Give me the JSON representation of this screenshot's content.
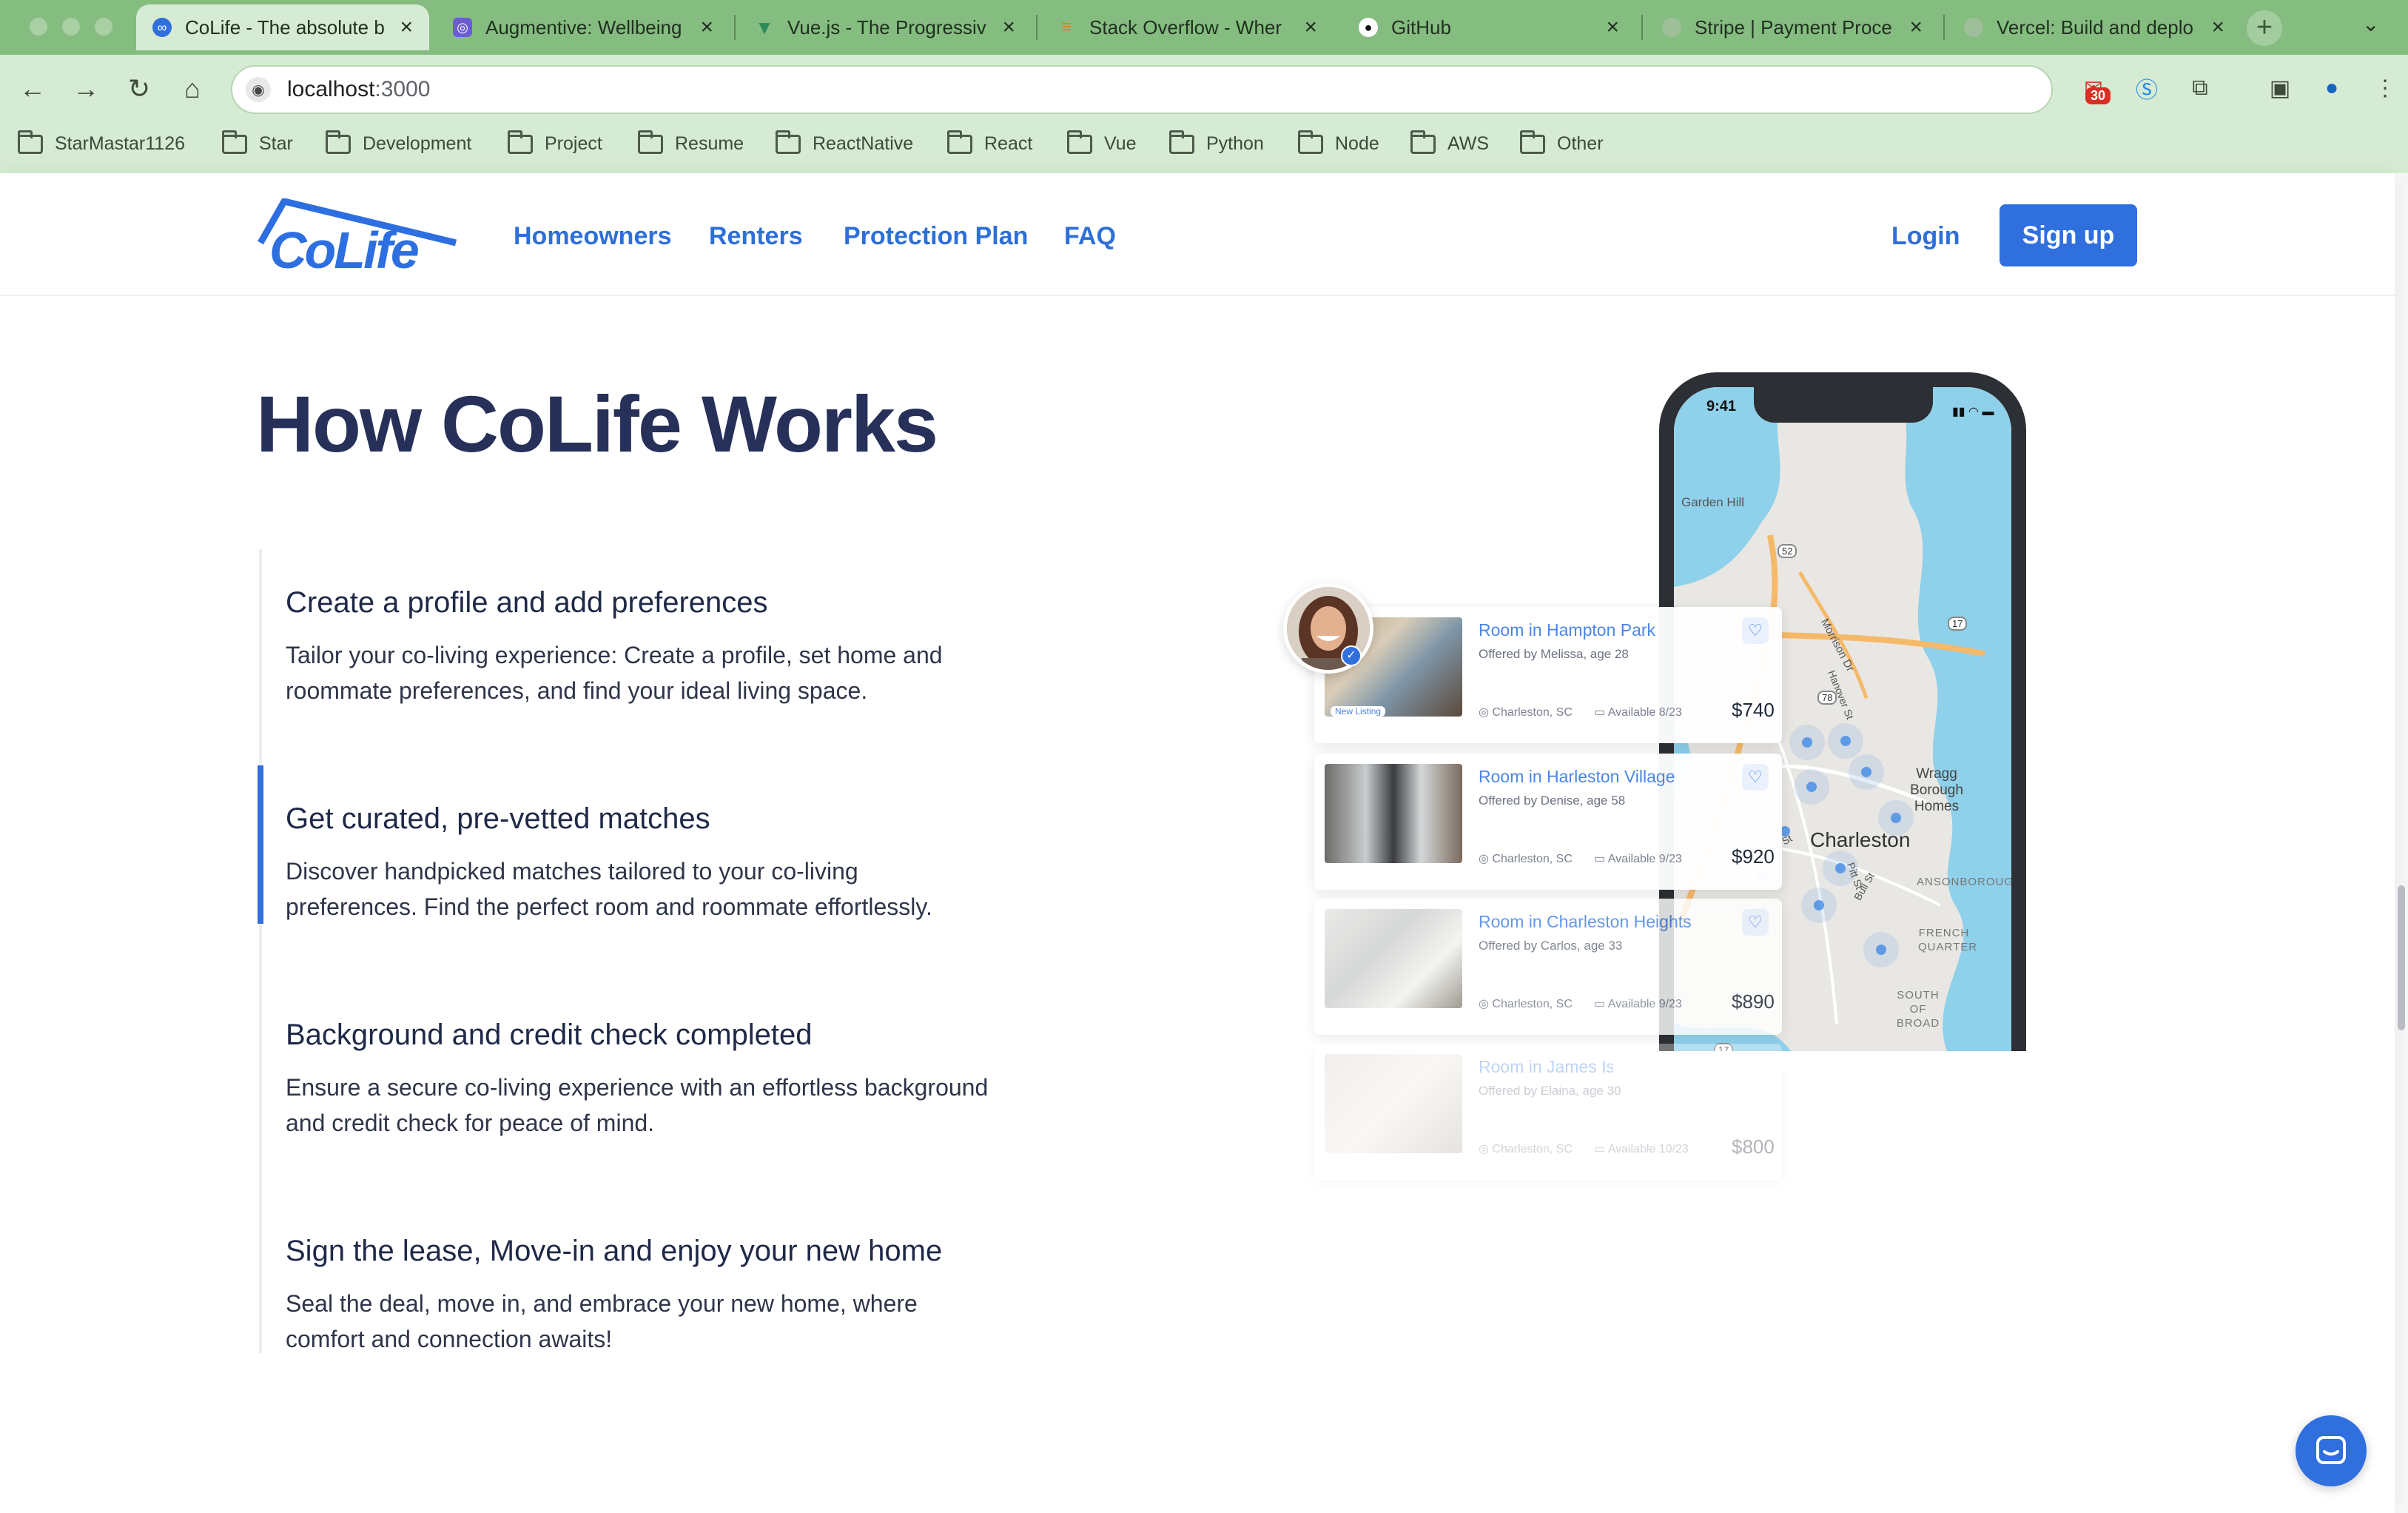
{
  "browser": {
    "tabs": [
      {
        "title": "CoLife - The absolute b",
        "icon": "colife-icon"
      },
      {
        "title": "Augmentive: Wellbeing",
        "icon": "augmentive-icon"
      },
      {
        "title": "Vue.js - The Progressiv",
        "icon": "vue-icon"
      },
      {
        "title": "Stack Overflow - Wher",
        "icon": "stackoverflow-icon"
      },
      {
        "title": "GitHub",
        "icon": "github-icon"
      },
      {
        "title": "Stripe | Payment Proce",
        "icon": "stripe-icon"
      },
      {
        "title": "Vercel: Build and deplo",
        "icon": "vercel-icon"
      }
    ],
    "url_host": "localhost",
    "url_port": ":3000",
    "badge_count": "30",
    "bookmarks": [
      "StarMastar1126",
      "Star",
      "Development",
      "Project",
      "Resume",
      "ReactNative",
      "React",
      "Vue",
      "Python",
      "Node",
      "AWS",
      "Other"
    ]
  },
  "nav": {
    "links": [
      "Homeowners",
      "Renters",
      "Protection Plan",
      "FAQ"
    ],
    "login": "Login",
    "signup": "Sign up"
  },
  "section": {
    "title": "How CoLife Works",
    "steps": [
      {
        "title": "Create a profile and add preferences",
        "desc": "Tailor your co-living experience: Create a profile, set home and roommate preferences, and find your ideal living space."
      },
      {
        "title": "Get curated, pre-vetted matches",
        "desc": "Discover handpicked matches tailored to your co-living preferences. Find the perfect room and roommate effortlessly."
      },
      {
        "title": "Background and credit check completed",
        "desc": "Ensure a secure co-living experience with an effortless background and credit check for peace of mind."
      },
      {
        "title": "Sign the lease, Move-in and enjoy your new home",
        "desc": "Seal the deal, move in, and embrace your new home, where comfort and connection awaits!"
      }
    ],
    "active_step": 1
  },
  "phone": {
    "time": "9:41",
    "map_labels": [
      "Charleston",
      "Wragg Borough Homes",
      "Garden Hill",
      "FRENCH QUARTER",
      "SOUTH OF BROAD",
      "ANSONBOROUGH",
      "Morrison Dr",
      "Bull St",
      "Pitt St",
      "Bee St",
      "Hanover St"
    ],
    "road_shields": [
      "17",
      "52",
      "78",
      "17",
      "30",
      "61"
    ],
    "listings": [
      {
        "title": "Room in Hampton Park",
        "offered": "Offered by Melissa, age 28",
        "location": "Charleston, SC",
        "available": "Available 8/23",
        "price": "$740",
        "tag": "New Listing"
      },
      {
        "title": "Room in Harleston Village",
        "offered": "Offered by Denise, age 58",
        "location": "Charleston, SC",
        "available": "Available 9/23",
        "price": "$920"
      },
      {
        "title": "Room in Charleston Heights",
        "offered": "Offered by Carlos, age 33",
        "location": "Charleston, SC",
        "available": "Available 9/23",
        "price": "$890"
      },
      {
        "title": "Room in James Island",
        "offered": "Offered by Elaina, age 30",
        "location": "Charleston, SC",
        "available": "Available 10/23",
        "price": "$800"
      }
    ]
  },
  "colors": {
    "brand": "#2f6fde",
    "heading": "#263059",
    "tabbar": "#85bd80",
    "toolbar": "#d6ebd3"
  }
}
